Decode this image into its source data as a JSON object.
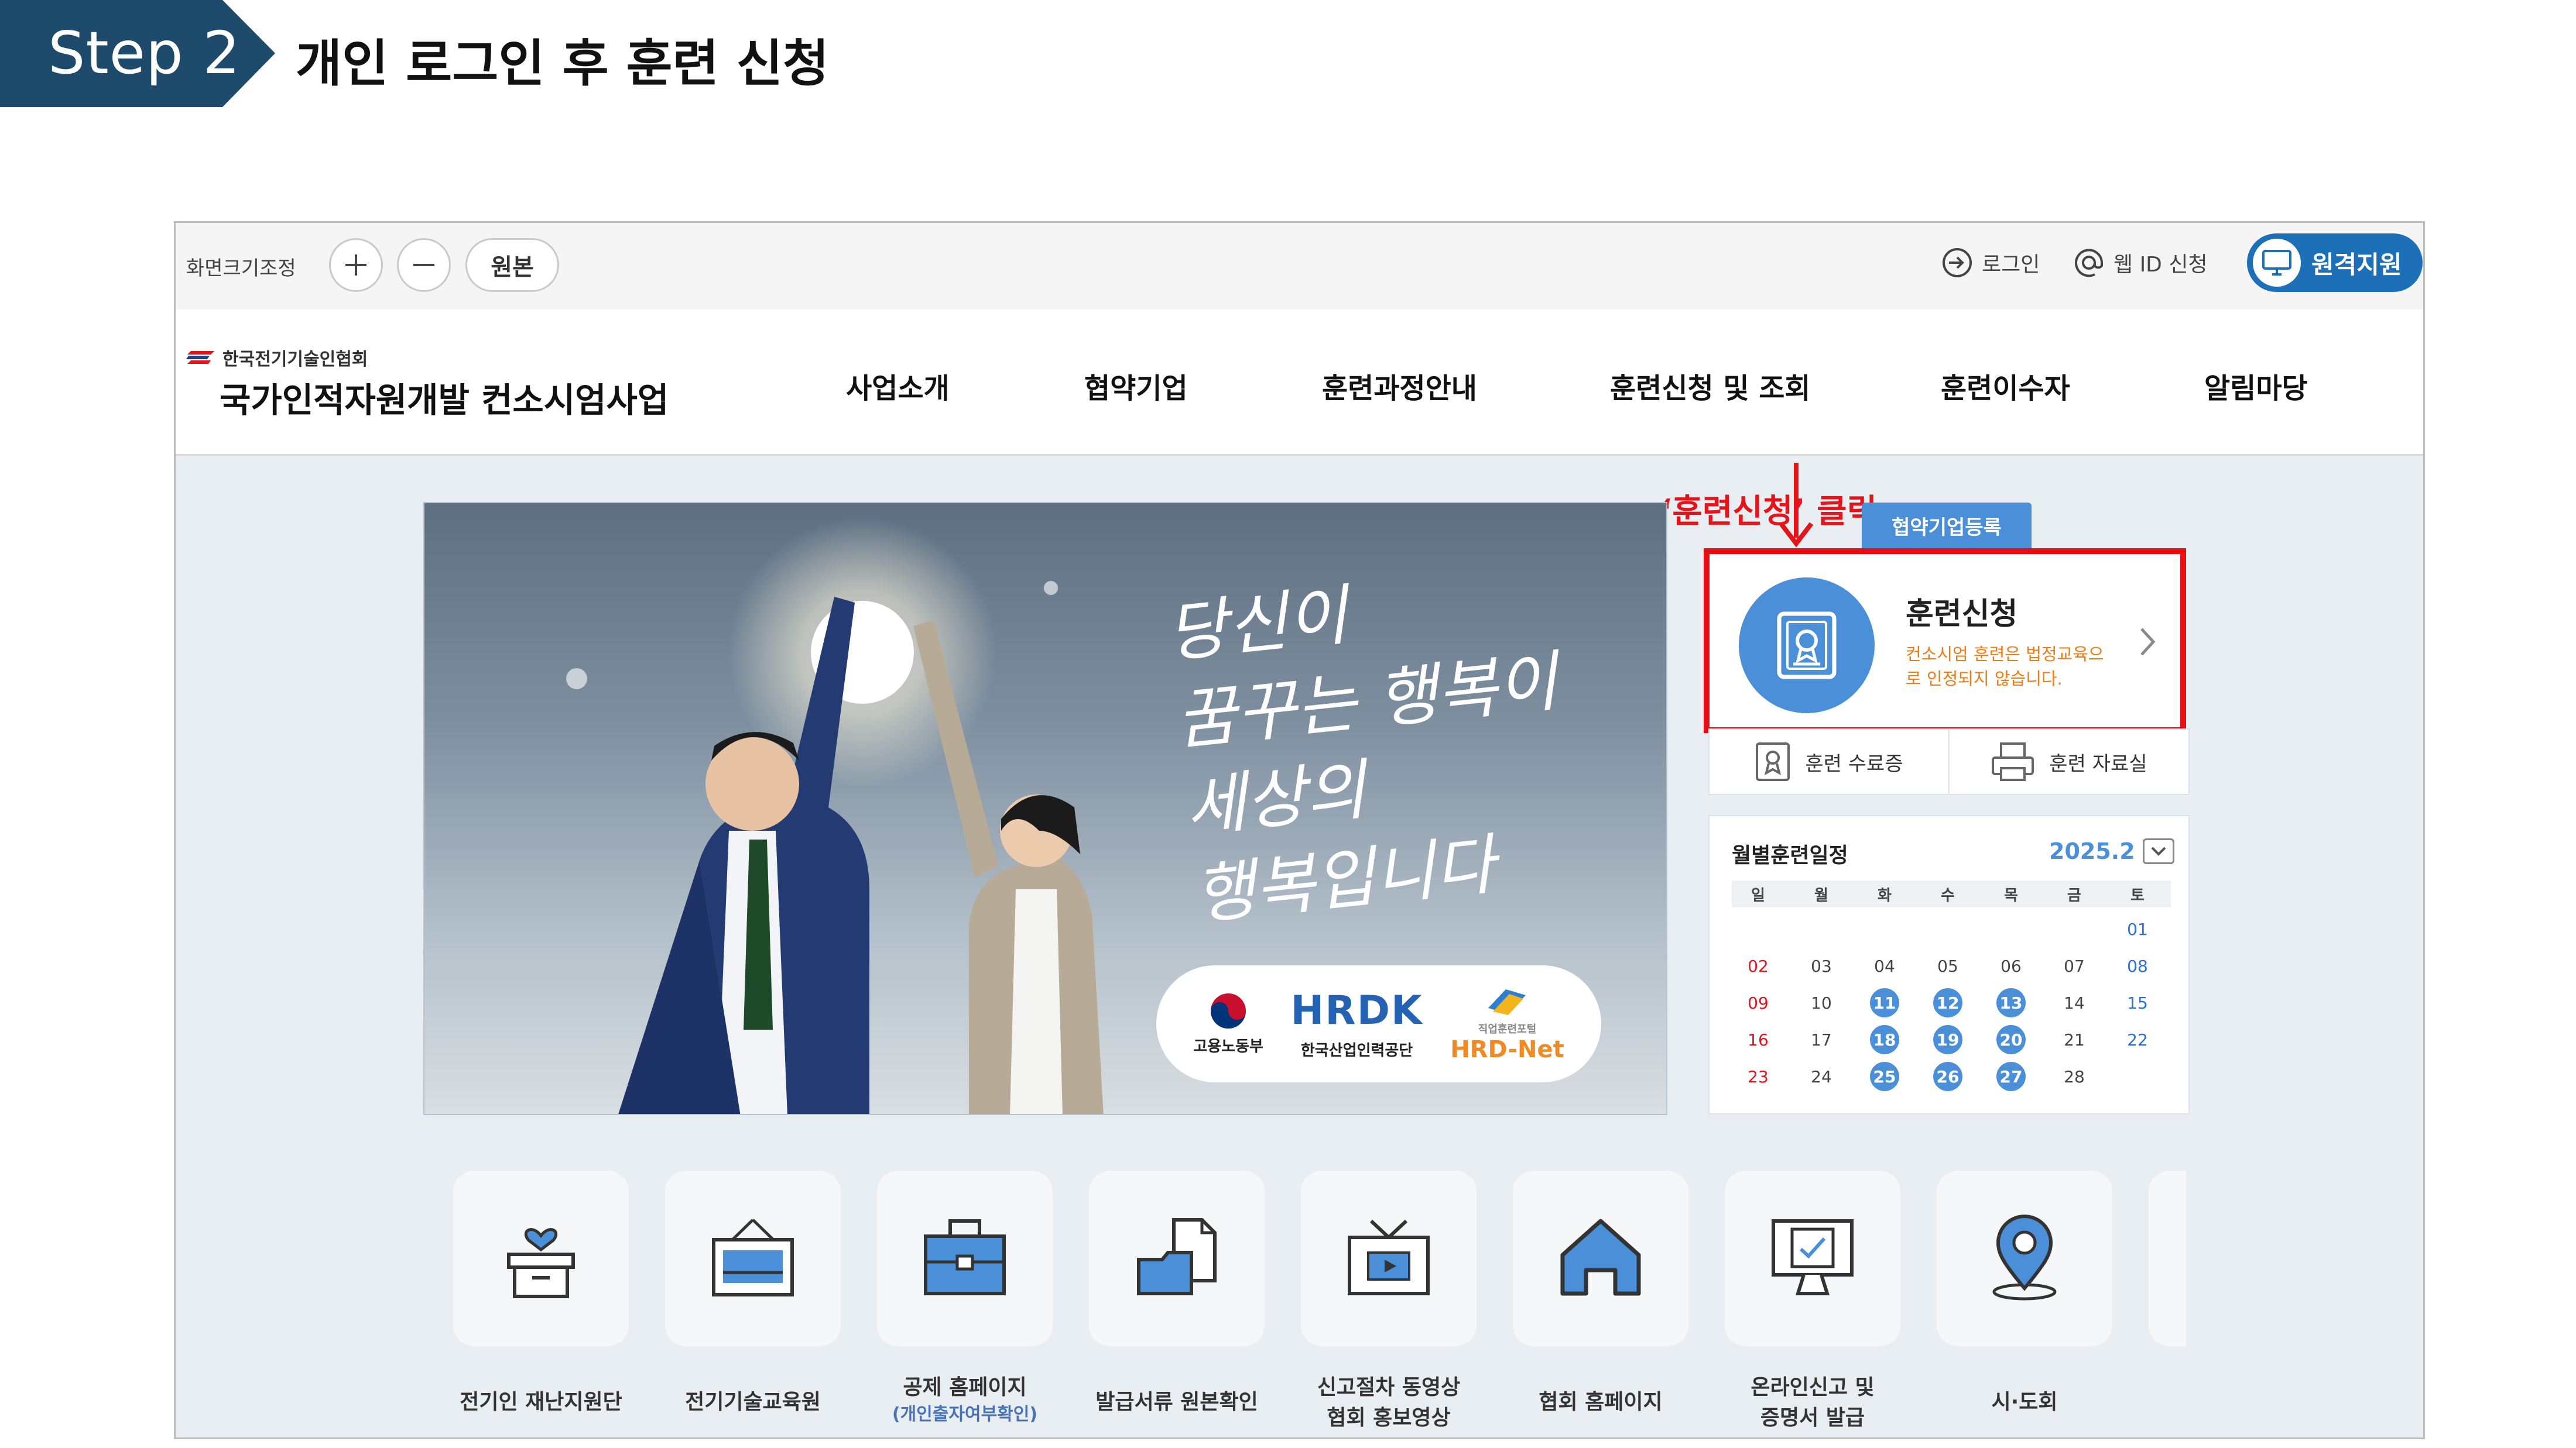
{
  "step": {
    "badge": "Step 2",
    "title": "개인 로그인 후 훈련 신청"
  },
  "util_bar": {
    "zoom_label": "화면크기조정",
    "zoom_in": "+",
    "zoom_out": "−",
    "original": "원본",
    "login": "로그인",
    "web_id": "웹 ID 신청",
    "remote_support": "원격지원"
  },
  "header": {
    "org": "한국전기기술인협회",
    "site_title": "국가인적자원개발 컨소시엄사업",
    "nav": [
      "사업소개",
      "협약기업",
      "훈련과정안내",
      "훈련신청 및 조회",
      "훈련이수자",
      "알림마당"
    ]
  },
  "annotation": {
    "text": "‘훈련신청’ 클릭",
    "color": "#e3141a"
  },
  "banner": {
    "slogan": [
      "당신이",
      "꿈꾸는 행복이",
      "세상의",
      "행복입니다"
    ],
    "logos": {
      "moel": "고용노동부",
      "hrdk_mark": "HRDK",
      "hrdk": "한국산업인력공단",
      "hrdnet_small": "직업훈련포털",
      "hrdnet": "HRD-Net"
    }
  },
  "right_panel": {
    "register_tab": "협약기업등록",
    "training_card": {
      "title": "훈련신청",
      "note": "컨소시엄 훈련은 법정교육으로 인정되지 않습니다."
    },
    "sub_links": [
      "훈련 수료증",
      "훈련 자료실"
    ],
    "calendar": {
      "title": "월별훈련일정",
      "month": "2025.2",
      "weekdays": [
        "일",
        "월",
        "화",
        "수",
        "목",
        "금",
        "토"
      ],
      "weeks": [
        [
          "",
          "",
          "",
          "",
          "",
          "",
          "01"
        ],
        [
          "02",
          "03",
          "04",
          "05",
          "06",
          "07",
          "08"
        ],
        [
          "09",
          "10",
          "11",
          "12",
          "13",
          "14",
          "15"
        ],
        [
          "16",
          "17",
          "18",
          "19",
          "20",
          "21",
          "22"
        ],
        [
          "23",
          "24",
          "25",
          "26",
          "27",
          "28",
          ""
        ]
      ],
      "highlighted_days": [
        "11",
        "12",
        "13",
        "18",
        "19",
        "20",
        "25",
        "26",
        "27"
      ]
    }
  },
  "quick_links": [
    {
      "label": "전기인 재난지원단",
      "sub": "",
      "icon": "gift-box-icon"
    },
    {
      "label": "전기기술교육원",
      "sub": "",
      "icon": "frame-icon"
    },
    {
      "label": "공제 홈페이지",
      "sub": "(개인출자여부확인)",
      "icon": "briefcase-icon"
    },
    {
      "label": "발급서류 원본확인",
      "sub": "",
      "icon": "document-folder-icon"
    },
    {
      "label": "신고절차 동영상",
      "sub2": "협회 홍보영상",
      "icon": "tv-icon"
    },
    {
      "label": "협회 홈페이지",
      "sub": "",
      "icon": "home-icon"
    },
    {
      "label": "온라인신고 및",
      "sub2": "증명서 발급",
      "icon": "monitor-certificate-icon"
    },
    {
      "label": "시·도회",
      "sub": "",
      "icon": "map-pin-icon"
    }
  ],
  "colors": {
    "accent": "#4a8fd8",
    "brand_dark": "#1e4a6b",
    "highlight_border": "#e60d14",
    "note_orange": "#f07c14"
  }
}
